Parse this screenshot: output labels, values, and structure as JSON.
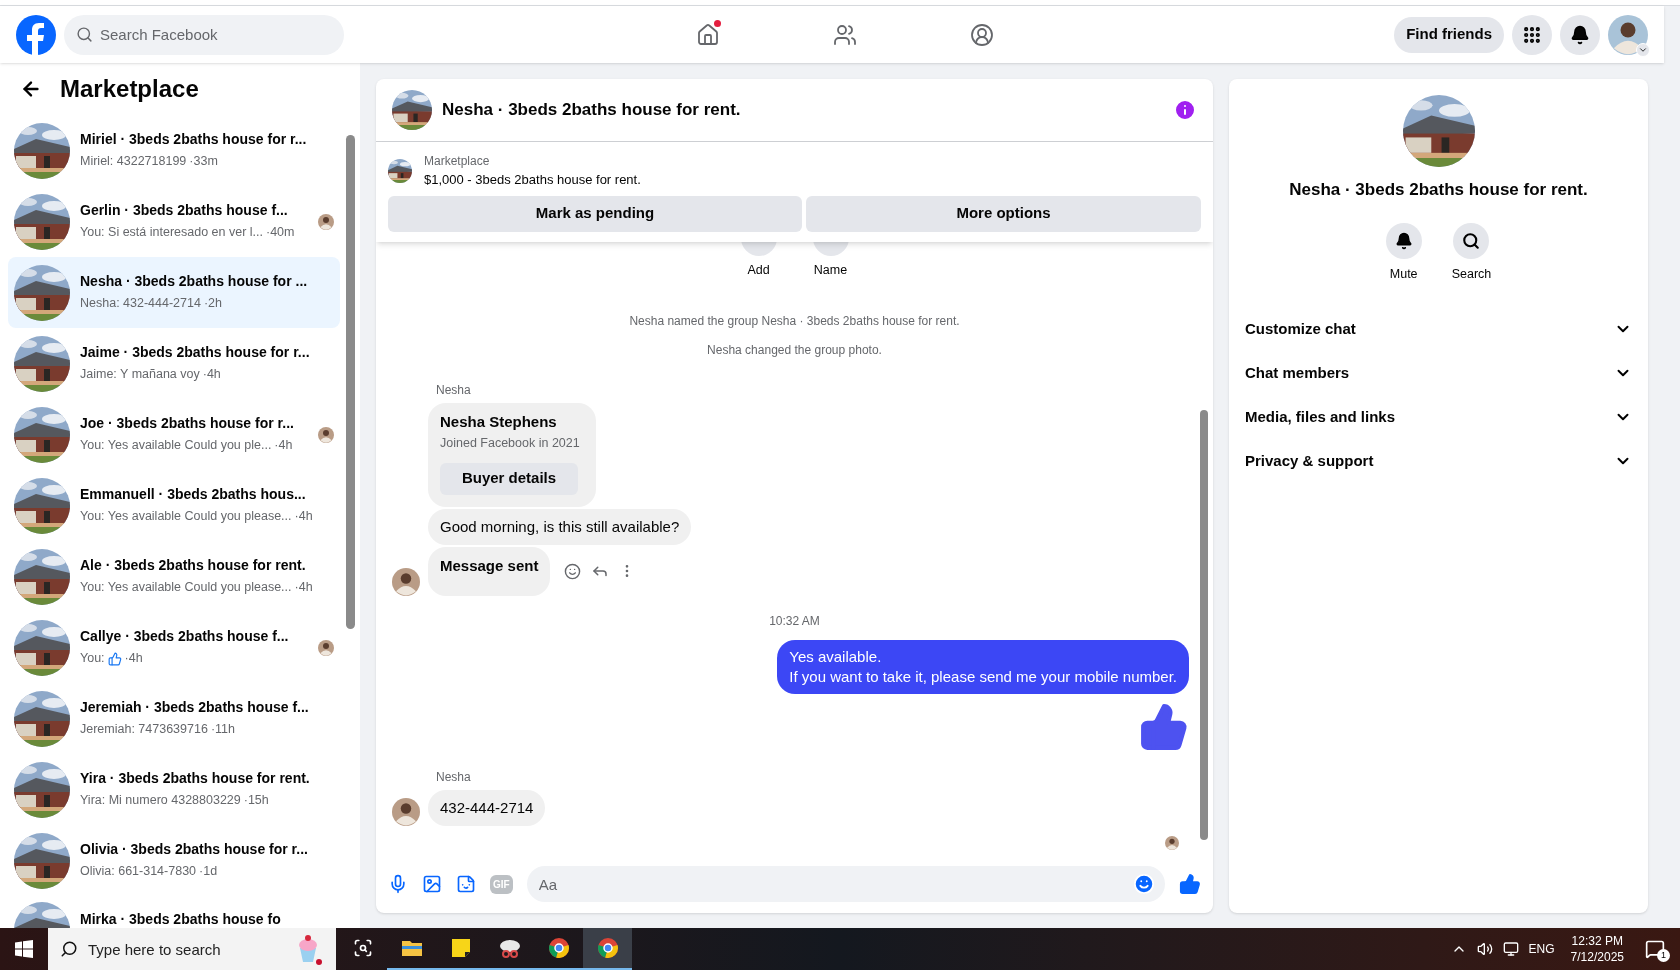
{
  "topbar": {
    "search": {
      "placeholder": "Search Facebook"
    },
    "nav": [
      {
        "kind": "home",
        "dot": true
      },
      {
        "kind": "friends",
        "dot": false
      },
      {
        "kind": "groups",
        "dot": false
      }
    ],
    "find_friends": "Find friends"
  },
  "sidebar": {
    "title": "Marketplace",
    "conversations": [
      {
        "title": "Miriel · 3beds 2baths house for r...",
        "preview": "Miriel: 4322718199",
        "time": "·33m",
        "seen": false,
        "selected": false,
        "kind": "text"
      },
      {
        "title": "Gerlin · 3beds 2baths house f...",
        "preview": "You: Si está interesado en ver l...",
        "time": "·40m",
        "seen": true,
        "selected": false,
        "kind": "text"
      },
      {
        "title": "Nesha · 3beds 2baths house for ...",
        "preview": "Nesha: 432-444-2714",
        "time": "·2h",
        "seen": false,
        "selected": true,
        "kind": "text"
      },
      {
        "title": "Jaime · 3beds 2baths house for r...",
        "preview": "Jaime: Y mañana voy",
        "time": "·4h",
        "seen": false,
        "selected": false,
        "kind": "text"
      },
      {
        "title": "Joe · 3beds 2baths house for r...",
        "preview": "You: Yes available Could you ple...",
        "time": "·4h",
        "seen": true,
        "selected": false,
        "kind": "text"
      },
      {
        "title": "Emmanuell · 3beds 2baths hous...",
        "preview": "You: Yes available Could you please...",
        "time": "·4h",
        "seen": false,
        "selected": false,
        "kind": "text"
      },
      {
        "title": "Ale · 3beds 2baths house for rent.",
        "preview": "You: Yes available Could you please...",
        "time": "·4h",
        "seen": false,
        "selected": false,
        "kind": "text"
      },
      {
        "title": "Callye · 3beds 2baths house f...",
        "preview": "You:",
        "time": "·4h",
        "seen": true,
        "selected": false,
        "kind": "like"
      },
      {
        "title": "Jeremiah · 3beds 2baths house f...",
        "preview": "Jeremiah: 7473639716",
        "time": "·11h",
        "seen": false,
        "selected": false,
        "kind": "text"
      },
      {
        "title": "Yira · 3beds 2baths house for rent.",
        "preview": "Yira: Mi numero 4328803229",
        "time": "·15h",
        "seen": false,
        "selected": false,
        "kind": "text"
      },
      {
        "title": "Olivia · 3beds 2baths house for r...",
        "preview": "Olivia: 661-314-7830",
        "time": "·1d",
        "seen": false,
        "selected": false,
        "kind": "text"
      },
      {
        "title": "Mirka · 3beds 2baths house fo",
        "seen": false,
        "selected": false,
        "kind": "partial"
      }
    ]
  },
  "chat": {
    "title": "Nesha · 3beds 2baths house for rent.",
    "listing": {
      "label": "Marketplace",
      "summary": "$1,000 - 3beds 2baths house for rent."
    },
    "buttons": [
      "Mark as pending",
      "More options"
    ],
    "top_actions": [
      "Add",
      "Name"
    ],
    "messages": [
      {
        "kind": "system",
        "text": "Nesha named the group Nesha · 3beds 2baths house for rent."
      },
      {
        "kind": "system",
        "text": "Nesha changed the group photo."
      },
      {
        "kind": "sender",
        "text": "Nesha"
      },
      {
        "kind": "card",
        "name": "Nesha Stephens",
        "detail": "Joined Facebook in 2021",
        "button": "Buyer details"
      },
      {
        "kind": "incoming",
        "text": "Good morning, is this still available?",
        "avatar": false,
        "bold": false
      },
      {
        "kind": "incoming",
        "text": "Message sent",
        "avatar": true,
        "bold": true
      },
      {
        "kind": "time",
        "text": "10:32 AM"
      },
      {
        "kind": "outgoing",
        "lines": [
          "Yes available.",
          "If you want to take it, please send me your mobile number."
        ]
      },
      {
        "kind": "like"
      },
      {
        "kind": "sender",
        "text": "Nesha"
      },
      {
        "kind": "incoming",
        "text": "432-444-2714",
        "avatar": true,
        "bold": false
      },
      {
        "kind": "seen"
      }
    ],
    "composer": {
      "placeholder": "Aa",
      "gif": "GIF"
    }
  },
  "details": {
    "title": "Nesha · 3beds 2baths house for rent.",
    "actions": [
      {
        "kind": "mute",
        "label": "Mute"
      },
      {
        "kind": "search",
        "label": "Search"
      }
    ],
    "sections": [
      {
        "label": "Customize chat",
        "expanded": false
      },
      {
        "label": "Chat members",
        "expanded": false
      },
      {
        "label": "Media, files and links",
        "expanded": false
      },
      {
        "label": "Privacy & support",
        "expanded": false
      }
    ]
  },
  "taskbar": {
    "search": {
      "placeholder": "Type here to search"
    },
    "apps": [
      {
        "kind": "taskview",
        "selected": false
      },
      {
        "kind": "explorer",
        "selected": false
      },
      {
        "kind": "notes",
        "selected": false
      },
      {
        "kind": "snip",
        "selected": false
      },
      {
        "kind": "chrome",
        "selected": false
      },
      {
        "kind": "chrome2",
        "selected": true
      }
    ],
    "language": "ENG",
    "time": "12:32 PM",
    "date": "7/12/2025",
    "notifications": "1"
  }
}
